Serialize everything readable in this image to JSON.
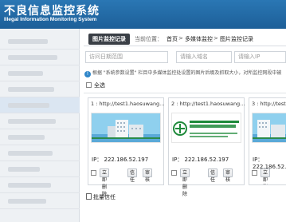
{
  "app": {
    "title": "不良信息监控系统",
    "subtitle": "Illegal Information Monitoring System"
  },
  "breadcrumb": {
    "active_tab": "图片监控记录",
    "position_label": "当前位置：",
    "items": [
      "首页",
      "多媒体监控",
      "图片监控记录"
    ],
    "separator": ">"
  },
  "filters": {
    "date_placeholder": "访问日期范围",
    "domain_placeholder": "请输入域名",
    "ip_placeholder": "请输入IP"
  },
  "notice": {
    "text": "根据 \"系统参数设置\" 栏目中多媒体监控处设置的图片后缀及抓取大小，对所监控网段中被"
  },
  "select_all_label": "全选",
  "cards": [
    {
      "url": "1 : http://test1.haosuwang...",
      "ip": "IP：  222.186.52.197",
      "actions": [
        "立即删除",
        "信任",
        "审核"
      ]
    },
    {
      "url": "2 : http://test1.haosuwang...",
      "ip": "IP：  222.186.52.197",
      "actions": [
        "立即删除",
        "信任",
        "审核"
      ]
    },
    {
      "url": "3 : http://test1.haosuwang...",
      "ip": "IP：  222.186.52.197",
      "actions": [
        "立即删除",
        "信任",
        "审核"
      ]
    }
  ],
  "batch_trust_label": "批量信任",
  "colors": {
    "header": "#1f65a3",
    "accent": "#2f86c9",
    "tab_dark": "#3a3f46"
  }
}
